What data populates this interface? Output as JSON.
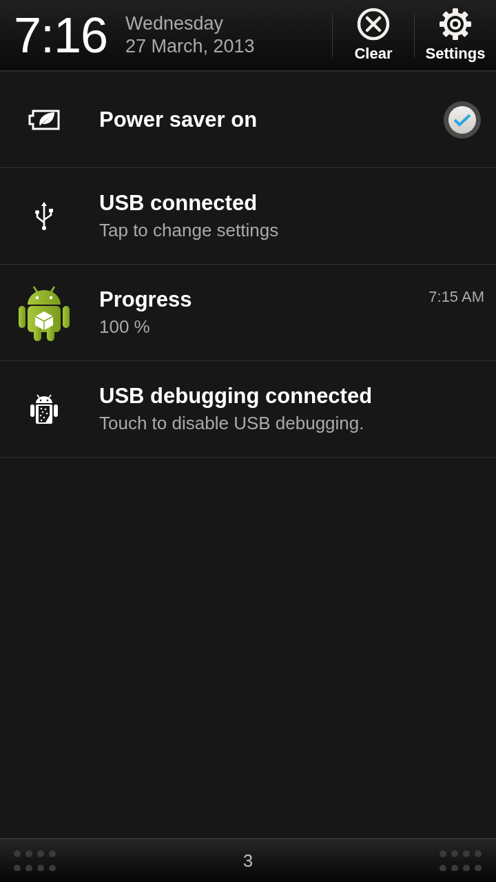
{
  "header": {
    "time": "7:16",
    "weekday": "Wednesday",
    "date": "27 March, 2013",
    "actions": [
      {
        "kind": "clear",
        "label": "Clear"
      },
      {
        "kind": "settings",
        "label": "Settings"
      }
    ]
  },
  "notifications": [
    {
      "kind": "power_saver",
      "title": "Power saver on",
      "checked": true
    },
    {
      "kind": "usb",
      "title": "USB connected",
      "subtitle": "Tap to change settings"
    },
    {
      "kind": "app",
      "title": "Progress",
      "subtitle": "100 %",
      "time": "7:15 AM"
    },
    {
      "kind": "debug",
      "title": "USB debugging connected",
      "subtitle": "Touch to disable USB debugging."
    }
  ],
  "footer": {
    "count": "3"
  }
}
